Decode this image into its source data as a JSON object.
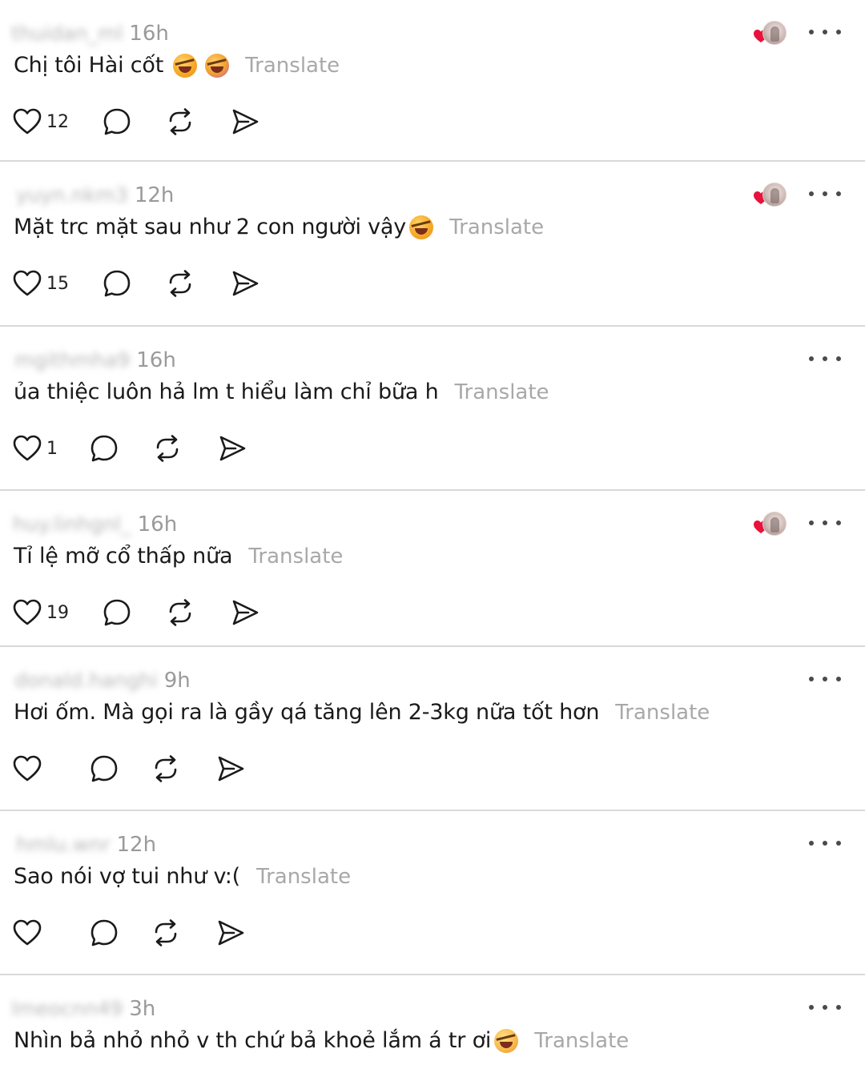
{
  "translate_label": "Translate",
  "colors": {
    "separator": "#d9d9d9",
    "muted_text": "#9a9a9a",
    "translate_text": "#a8a8a8",
    "heart_red": "#e8123c"
  },
  "icons": {
    "like": "heart-outline-icon",
    "reply": "comment-bubble-icon",
    "repost": "repost-arrows-icon",
    "share": "send-arrow-icon",
    "more": "more-dots-icon",
    "author_liked": "author-liked-heart-avatar-icon"
  },
  "replies": [
    {
      "username": "thuidan_ml",
      "time": "16h",
      "text": "Chị tôi Hài cốt",
      "emojis": [
        "rofl",
        "rofl"
      ],
      "likes": "12",
      "author_liked": true
    },
    {
      "username": "yuyn.nkm3",
      "time": "12h",
      "text": "Mặt trc mặt sau như 2 con người vậy",
      "emojis": [
        "rofl"
      ],
      "likes": "15",
      "author_liked": true
    },
    {
      "username": "mgithmha9",
      "time": "16h",
      "text": "ủa thiệc luôn hả lm t hiểu làm chỉ bữa h",
      "emojis": [],
      "likes": "1",
      "author_liked": false
    },
    {
      "username": "huy.linhgnl_",
      "time": "16h",
      "text": "Tỉ lệ mỡ cổ thấp nữa",
      "emojis": [],
      "likes": "19",
      "author_liked": true
    },
    {
      "username": "donald.hanghi",
      "time": "9h",
      "text": "Hơi ốm. Mà gọi ra là gầy qá tăng lên 2-3kg nữa tốt hơn",
      "emojis": [],
      "likes": "",
      "author_liked": false
    },
    {
      "username": "hmlu.wnr",
      "time": "12h",
      "text": "Sao nói vợ tui như v:(",
      "emojis": [],
      "likes": "",
      "author_liked": false
    },
    {
      "username": "lmeocnn49",
      "time": "3h",
      "text": "Nhìn bả nhỏ nhỏ v th chứ bả khoẻ lắm á tr ơi",
      "emojis": [
        "sweat"
      ],
      "likes": "",
      "author_liked": false
    }
  ]
}
